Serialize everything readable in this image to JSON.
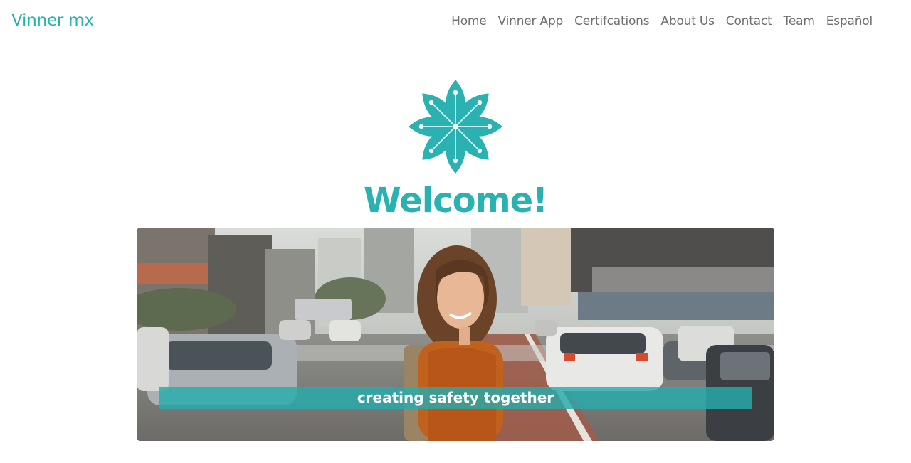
{
  "brand": {
    "name": "Vinner mx",
    "color": "#26b3b0"
  },
  "nav": {
    "items": [
      {
        "label": "Home"
      },
      {
        "label": "Vinner App"
      },
      {
        "label": "Certifcations"
      },
      {
        "label": "About Us"
      },
      {
        "label": "Contact"
      },
      {
        "label": "Team"
      },
      {
        "label": "Español"
      }
    ]
  },
  "hero": {
    "logo_icon": "flower-logo-icon",
    "heading": "Welcome!",
    "image": "smiling-woman-city-street-photo",
    "caption": "creating safety together"
  },
  "colors": {
    "accent": "#2ab2b2",
    "nav_text": "#6f6f6f"
  }
}
